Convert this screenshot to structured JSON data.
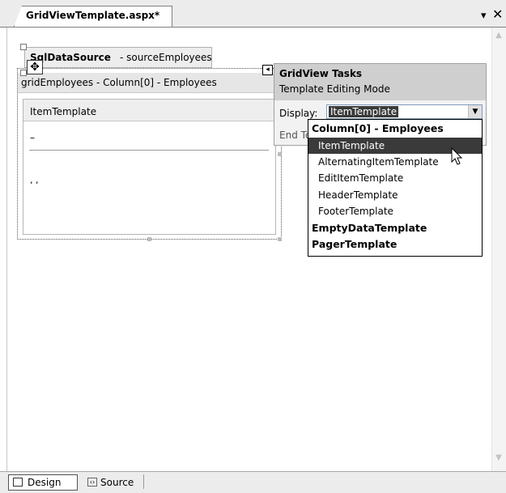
{
  "document_tab": {
    "title": "GridViewTemplate.aspx*",
    "dropdown_glyph": "▾",
    "close_glyph": "✕"
  },
  "datasource": {
    "type_label": "SqlDataSource",
    "id_label": "- sourceEmployees",
    "move_glyph": "✥"
  },
  "grid": {
    "header_label": "gridEmployees - Column[0] - Employees",
    "template_label": "ItemTemplate",
    "dash_text": "–",
    "commas_text": ", ,"
  },
  "smart_tag": {
    "arrow_glyph": "◂",
    "title": "GridView Tasks",
    "subtitle": "Template Editing Mode",
    "display_label": "Display:",
    "display_value": "ItemTemplate",
    "end_link": "End Template Editing",
    "dropdown_items": [
      {
        "label": "Column[0] - Employees",
        "kind": "group"
      },
      {
        "label": "ItemTemplate",
        "kind": "child",
        "selected": true
      },
      {
        "label": "AlternatingItemTemplate",
        "kind": "child"
      },
      {
        "label": "EditItemTemplate",
        "kind": "child"
      },
      {
        "label": "HeaderTemplate",
        "kind": "child"
      },
      {
        "label": "FooterTemplate",
        "kind": "child"
      },
      {
        "label": "EmptyDataTemplate",
        "kind": "group"
      },
      {
        "label": "PagerTemplate",
        "kind": "group"
      }
    ]
  },
  "bottom_bar": {
    "design_label": "Design",
    "source_label": "Source"
  },
  "colors": {
    "selection": "#3a3a3a",
    "panel_header": "#cfcfcf"
  }
}
